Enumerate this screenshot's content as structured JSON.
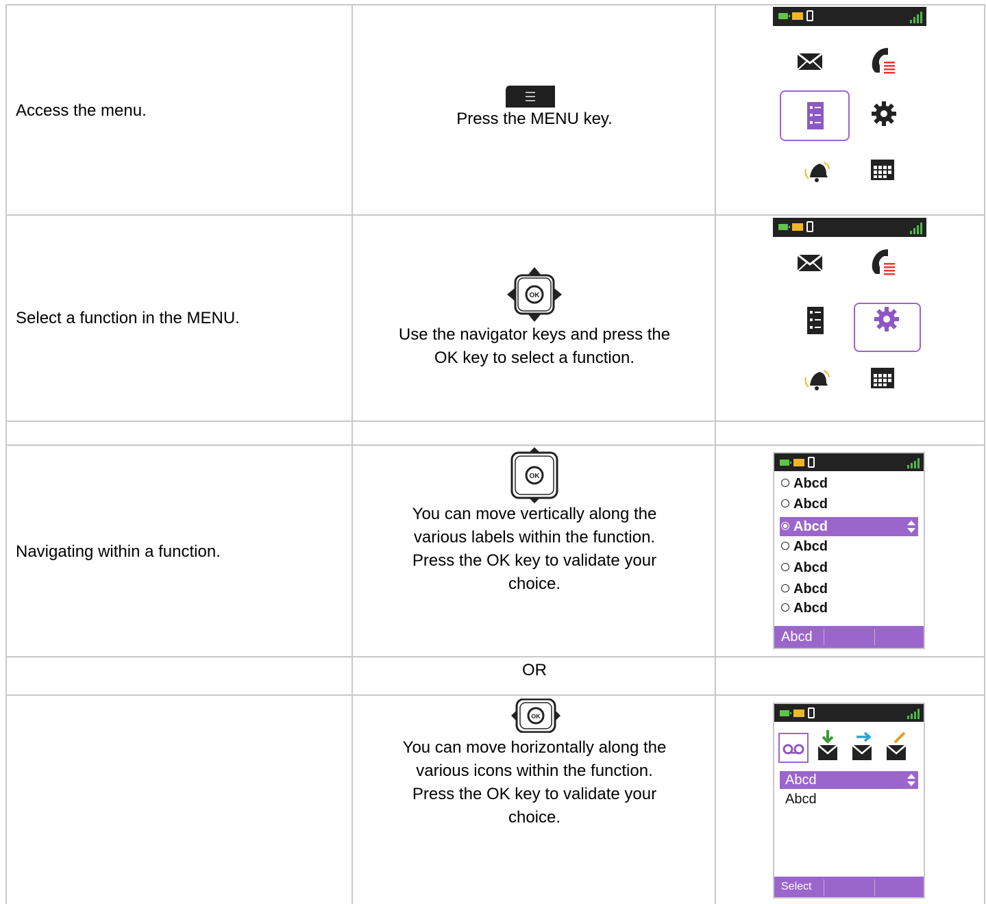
{
  "rows": [
    {
      "action": "Access the menu.",
      "instruction_lines": [
        "Press the MENU key."
      ],
      "key_icon": "menu-key-icon"
    },
    {
      "action": "Select a function in the MENU.",
      "instruction_lines": [
        "Use the navigator keys and press the",
        "OK key to select a function."
      ],
      "key_icon": "navigator-4way-icon"
    },
    {
      "action": "Navigating within a function.",
      "instruction_lines": [
        "You can move vertically along the",
        "various labels within the function.",
        "Press the OK key to validate your",
        "choice."
      ],
      "key_icon": "navigator-vertical-icon"
    },
    {
      "or_label": "OR"
    },
    {
      "instruction_lines": [
        "You can move horizontally along the",
        "various icons within the function.",
        "Press the OK key to validate your",
        "choice."
      ],
      "key_icon": "navigator-horizontal-icon"
    }
  ],
  "key_labels": {
    "ok": "OK"
  },
  "screens": {
    "list_screen": {
      "items": [
        "Abcd",
        "Abcd",
        "Abcd",
        "Abcd",
        "Abcd",
        "Abcd",
        "Abcd"
      ],
      "selected_index": 2,
      "softkey": "Abcd"
    },
    "icon_screen": {
      "items": [
        "Abcd",
        "Abcd"
      ],
      "softkey": "Select"
    }
  },
  "colors": {
    "accent": "#9b66cc",
    "statusbar": "#222222",
    "signal": "#4fb94a",
    "battery": "#61c44a",
    "message": "#f0b62a"
  }
}
